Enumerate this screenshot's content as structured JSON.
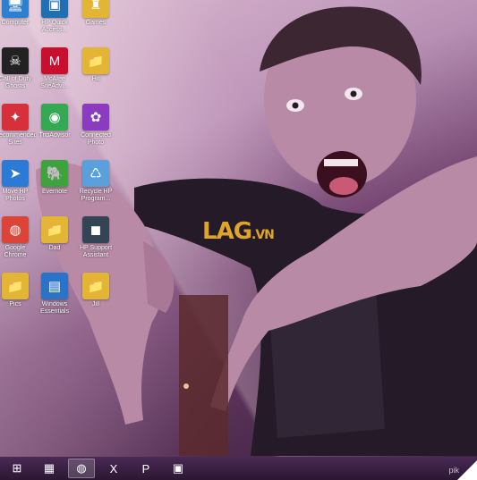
{
  "desktop": {
    "icons": [
      {
        "label": "Computer",
        "glyph": "🖥",
        "color": "#2d7fd0"
      },
      {
        "label": "HP Quick Access...",
        "glyph": "▣",
        "color": "#1f6fb2"
      },
      {
        "label": "Games",
        "glyph": "♜",
        "color": "#e2b534"
      },
      {
        "label": "Call of Duty Ghosts",
        "glyph": "☠",
        "color": "#222222"
      },
      {
        "label": "McAfee SiteAdvi...",
        "glyph": "M",
        "color": "#c8102e"
      },
      {
        "label": "Hit",
        "glyph": "📁",
        "color": "#e2b534"
      },
      {
        "label": "Recommended Sites",
        "glyph": "✦",
        "color": "#d6303a"
      },
      {
        "label": "TripAdvisor",
        "glyph": "◉",
        "color": "#34a853"
      },
      {
        "label": "Connected Photo",
        "glyph": "✿",
        "color": "#8a3bbf"
      },
      {
        "label": "Move HP Photos",
        "glyph": "➤",
        "color": "#2a7ad6"
      },
      {
        "label": "Evernote",
        "glyph": "🐘",
        "color": "#3da33c"
      },
      {
        "label": "Recycle HP Program...",
        "glyph": "♺",
        "color": "#5aa0dd"
      },
      {
        "label": "Google Chrome",
        "glyph": "◍",
        "color": "#db4437"
      },
      {
        "label": "Dad",
        "glyph": "📁",
        "color": "#e2b534"
      },
      {
        "label": "HP Support Assistant",
        "glyph": "◼",
        "color": "#334455"
      },
      {
        "label": "Pics",
        "glyph": "📁",
        "color": "#e2b534"
      },
      {
        "label": "Windows Essentials",
        "glyph": "▤",
        "color": "#2a73c9"
      },
      {
        "label": "Jill",
        "glyph": "📁",
        "color": "#e2b534"
      }
    ]
  },
  "taskbar": {
    "items": [
      {
        "name": "start-icon",
        "glyph": "⊞",
        "active": false
      },
      {
        "name": "file-explorer-icon",
        "glyph": "▦",
        "active": false
      },
      {
        "name": "chrome-icon",
        "glyph": "◍",
        "active": true
      },
      {
        "name": "excel-icon",
        "glyph": "X",
        "active": false
      },
      {
        "name": "powerpoint-icon",
        "glyph": "P",
        "active": false
      },
      {
        "name": "photo-viewer-icon",
        "glyph": "▣",
        "active": false
      }
    ]
  },
  "watermark": {
    "main": "LAG",
    "suffix": ".VN"
  },
  "corner_text": "pik",
  "colors": {
    "accent": "#e2b534",
    "taskbar": "#2b1633"
  }
}
